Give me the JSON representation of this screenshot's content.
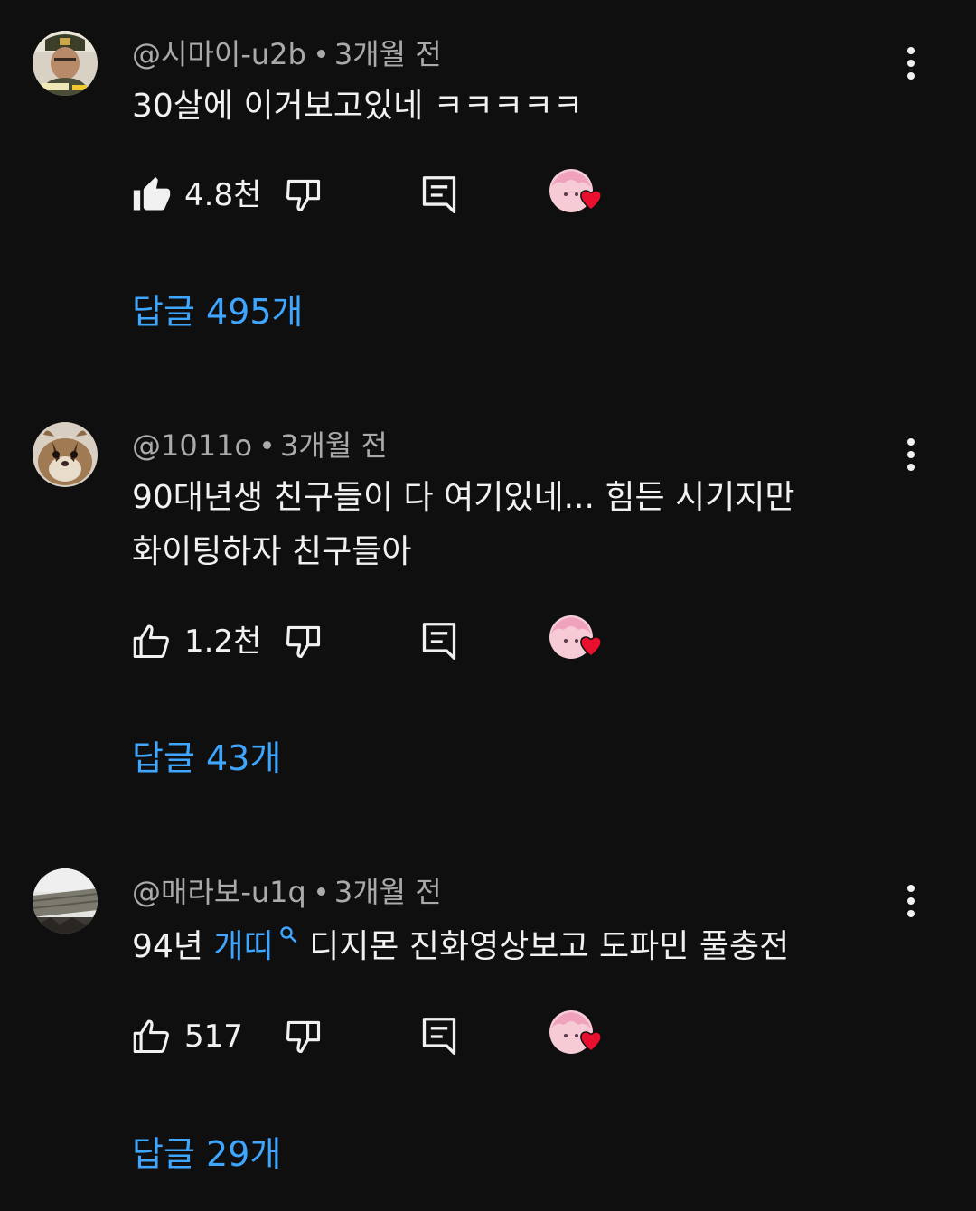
{
  "comments": [
    {
      "author": "@시마이-u2b",
      "time": "3개월 전",
      "text": "30살에 이거보고있네 ㅋㅋㅋㅋㅋ",
      "likes": "4.8천",
      "like_filled": true,
      "replies": "답글 495개"
    },
    {
      "author": "@1011o",
      "time": "3개월 전",
      "text_line1": "90대년생 친구들이 다 여기있네... 힘든 시기지만",
      "text_line2": "화이팅하자 친구들아",
      "likes": "1.2천",
      "like_filled": false,
      "replies": "답글 43개"
    },
    {
      "author": "@매라보-u1q",
      "time": "3개월 전",
      "text_before": "94년 ",
      "hashtag": "개띠",
      "text_after": " 디지몬 진화영상보고 도파민 풀충전",
      "likes": "517",
      "like_filled": false,
      "replies": "답글 29개"
    }
  ],
  "colors": {
    "background": "#0f0f0f",
    "link": "#3ea6ff",
    "heart": "#e8102e"
  },
  "icons": [
    "like-icon",
    "dislike-icon",
    "reply-icon",
    "creator-heart-icon",
    "more-options-icon",
    "search-icon"
  ]
}
